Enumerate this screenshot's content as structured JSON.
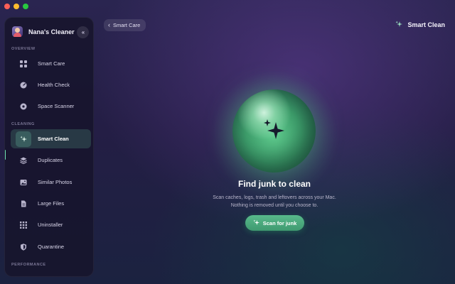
{
  "app": {
    "profile_name": "Nana's Cleaner"
  },
  "sidebar": {
    "collapse_label": "«",
    "sections": {
      "overview": "OVERVIEW",
      "cleaning": "CLEANING",
      "performance": "PERFORMANCE"
    },
    "items": [
      {
        "label": "Smart Care",
        "icon": "grid-icon"
      },
      {
        "label": "Health Check",
        "icon": "gauge-icon"
      },
      {
        "label": "Space Scanner",
        "icon": "disk-icon"
      },
      {
        "label": "Smart Clean",
        "icon": "sparkle-icon",
        "active": true
      },
      {
        "label": "Duplicates",
        "icon": "layers-icon"
      },
      {
        "label": "Similar Photos",
        "icon": "photo-icon"
      },
      {
        "label": "Large Files",
        "icon": "file-icon"
      },
      {
        "label": "Uninstaller",
        "icon": "apps-grid-icon"
      },
      {
        "label": "Quarantine",
        "icon": "shield-icon"
      }
    ]
  },
  "header": {
    "back_label": "Smart Care",
    "title": "Smart Clean"
  },
  "main": {
    "headline": "Find junk to clean",
    "description_line1": "Scan caches, logs, trash and leftovers across your Mac.",
    "description_line2": "Nothing is removed until you choose to.",
    "scan_button": "Scan for junk"
  },
  "colors": {
    "accent": "#58b98b",
    "active_indicator": "#6fe3b4"
  }
}
